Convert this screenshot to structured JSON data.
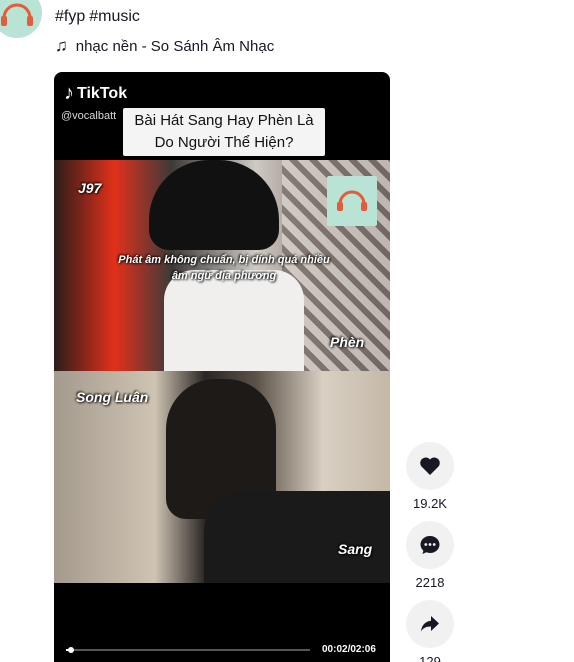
{
  "post": {
    "hashtags": [
      "#fyp",
      "#music"
    ],
    "music_icon": "music-note-icon",
    "music_label": "nhạc nền - So Sánh Âm Nhạc"
  },
  "video": {
    "brand": "TikTok",
    "username": "@vocalbatt",
    "title_line1": "Bài Hát Sang Hay Phèn Là",
    "title_line2": "Do Người Thể Hiện?",
    "caption_j97": "J97",
    "caption_phen": "Phèn",
    "subtitle_line1": "Phát âm không chuẩn, bị dính quá nhiều",
    "subtitle_line2": "âm ngữ địa phương",
    "caption_song_luan": "Song Luân",
    "caption_sang": "Sang",
    "time": "00:02/02:06",
    "progress_fraction": 0.02
  },
  "actions": {
    "like_count": "19.2K",
    "comment_count": "2218",
    "share_count": "129"
  },
  "colors": {
    "background": "#ffffff",
    "text": "#161823",
    "action_circle": "#f1f1f2",
    "video_bg": "#000000"
  }
}
